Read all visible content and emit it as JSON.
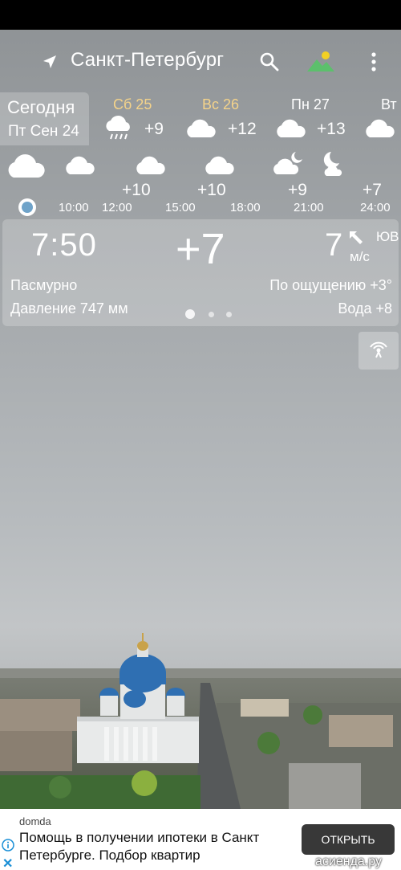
{
  "header": {
    "city": "Санкт-Петербург",
    "icons": [
      "location-arrow-icon",
      "search-icon",
      "landscape-icon",
      "more-vert-icon"
    ]
  },
  "days": {
    "today": {
      "label": "Сегодня",
      "date": "Пт Сен 24"
    },
    "items": [
      {
        "name": "Сб 25",
        "temp": "+9",
        "weekend": true,
        "icon": "rain-cloud-icon"
      },
      {
        "name": "Вс 26",
        "temp": "+12",
        "weekend": true,
        "icon": "cloud-icon"
      },
      {
        "name": "Пн 27",
        "temp": "+13",
        "weekend": false,
        "icon": "cloud-icon"
      },
      {
        "name": "Вт",
        "temp": "",
        "weekend": false,
        "icon": "cloud-icon"
      }
    ]
  },
  "hourly": {
    "temps": [
      "+10",
      "+10",
      "+9",
      "+7"
    ],
    "times": [
      "10:00",
      "12:00",
      "15:00",
      "18:00",
      "21:00",
      "24:00"
    ]
  },
  "current": {
    "time": "7:50",
    "temp": "+7",
    "wind_speed": "7",
    "wind_dir": "ЮВ",
    "wind_unit": "м/с",
    "condition": "Пасмурно",
    "feels_like": "По ощущению +3°",
    "pressure": "Давление 747 мм",
    "water": "Вода +8"
  },
  "ad": {
    "source": "domda",
    "text": "Помощь в получении ипотеки в Санкт Петербурге. Подбор квартир",
    "button": "ОТКРЫТЬ",
    "watermark": "асиенда.ру"
  },
  "colors": {
    "weekend": "#f4d38a",
    "now_dot": "#6fa3c9",
    "ad_button": "#383838"
  }
}
